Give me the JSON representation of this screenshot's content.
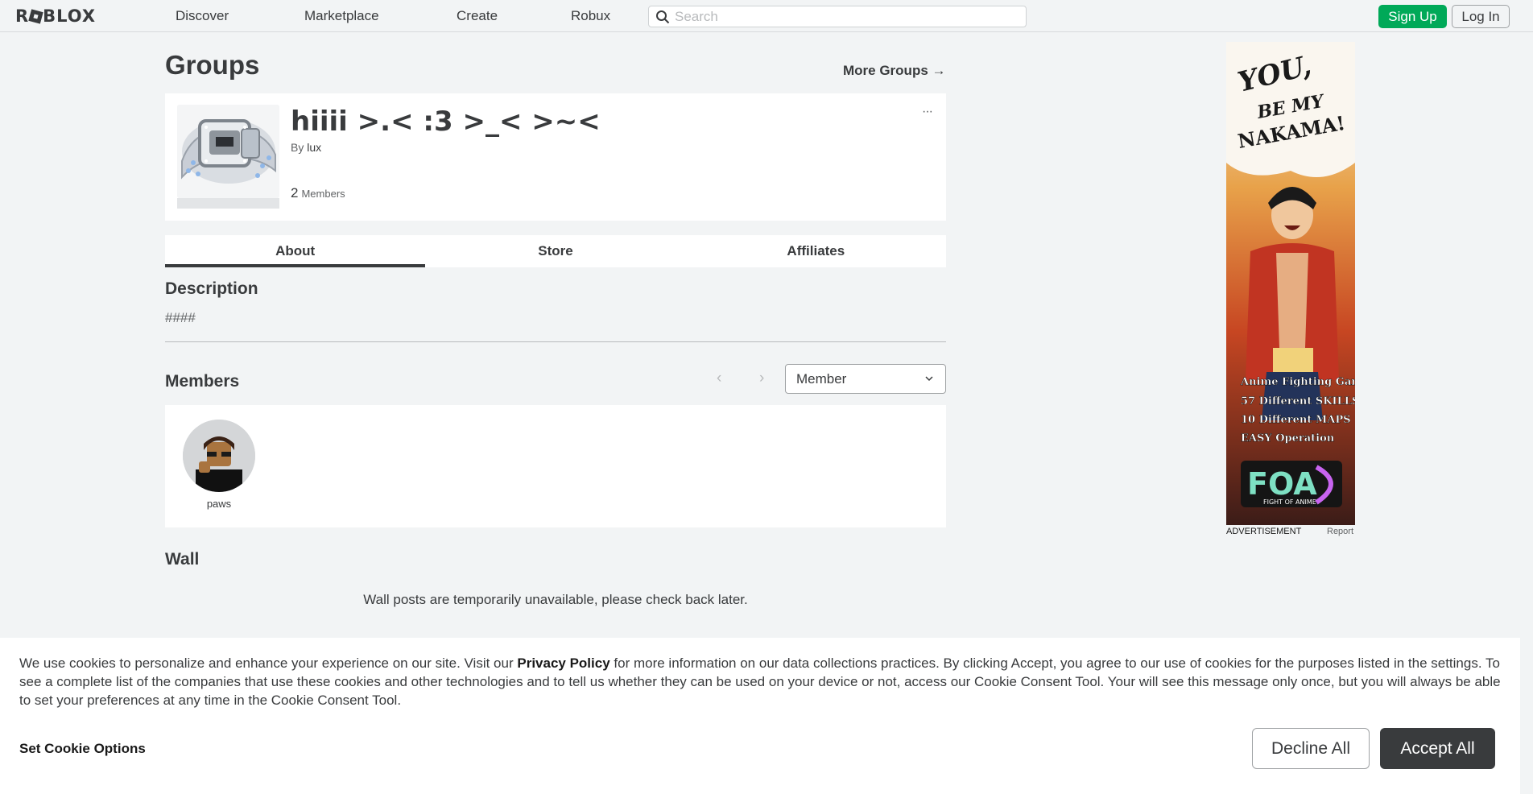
{
  "nav": {
    "logo": "ROBLOX",
    "links": [
      "Discover",
      "Marketplace",
      "Create",
      "Robux"
    ],
    "search_placeholder": "Search",
    "signup_label": "Sign Up",
    "login_label": "Log In"
  },
  "page": {
    "title": "Groups",
    "more_groups": "More Groups",
    "more_groups_arrow": "→"
  },
  "group": {
    "name": "hiiii >.< :3 >_< >~<",
    "by_label": "By",
    "owner": "lux",
    "member_count": "2",
    "members_label": "Members",
    "more_menu": "···"
  },
  "tabs": [
    "About",
    "Store",
    "Affiliates"
  ],
  "about": {
    "description_heading": "Description",
    "description_text": "####"
  },
  "members": {
    "heading": "Members",
    "prev_icon": "‹",
    "next_icon": "›",
    "role_selected": "Member",
    "list": [
      {
        "name": "paws"
      }
    ]
  },
  "wall": {
    "heading": "Wall",
    "message": "Wall posts are temporarily unavailable, please check back later."
  },
  "ad": {
    "headline": "YOU, BE MY NAKAMA!",
    "lines": [
      "Anime Fighting Game",
      "57 Different SKILLS",
      "10 Different MAPS",
      "EASY Operation"
    ],
    "brand": "FOA",
    "brand_sub": "FIGHT OF ANIME",
    "label": "ADVERTISEMENT",
    "report": "Report"
  },
  "cookie": {
    "text_before": "We use cookies to personalize and enhance your experience on our site. Visit our ",
    "privacy_policy": "Privacy Policy",
    "text_after": " for more information on our data collections practices. By clicking Accept, you agree to our use of cookies for the purposes listed in the settings. To see a complete list of the companies that use these cookies and other technologies and to tell us whether they can be used on your device or not, access our Cookie Consent Tool. Your will see this message only once, but you will always be able to set your preferences at any time in the Cookie Consent Tool.",
    "set_options": "Set Cookie Options",
    "decline": "Decline All",
    "accept": "Accept All"
  },
  "colors": {
    "accent_green": "#00a958",
    "text_dark": "#393b3d",
    "background": "#f2f4f5"
  }
}
